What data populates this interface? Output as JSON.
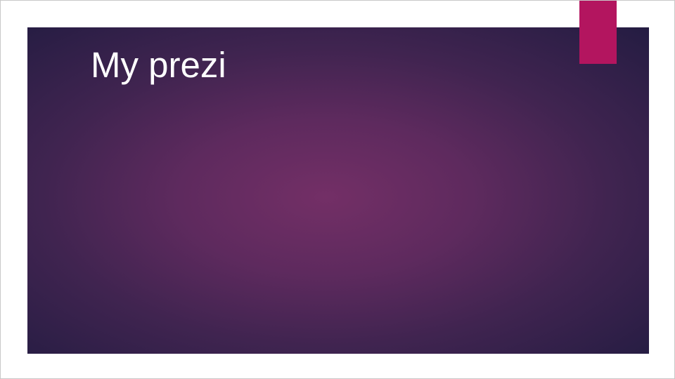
{
  "slide": {
    "title": "My prezi"
  },
  "colors": {
    "background": "#ffffff",
    "frame_border": "#c8c8c8",
    "slide_center": "#732f66",
    "slide_edge": "#241c42",
    "accent": "#b3155f",
    "title_text": "#ffffff"
  }
}
